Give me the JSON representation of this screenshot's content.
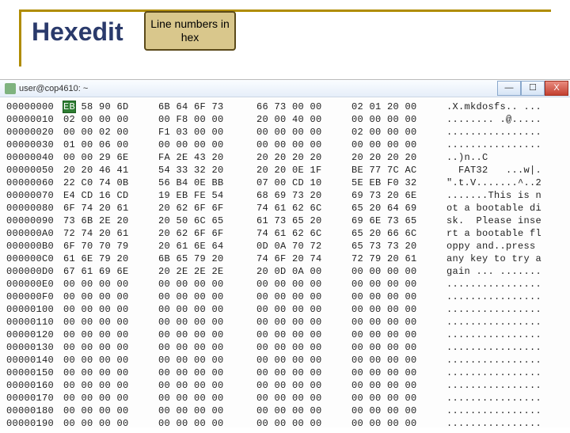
{
  "title": "Hexedit",
  "callout": "Line numbers in hex",
  "window": {
    "title": "user@cop4610: ~"
  },
  "hex_rows": [
    {
      "off": "00000000",
      "h": [
        "EB",
        "58",
        "90",
        "6D",
        "6B",
        "64",
        "6F",
        "73",
        "66",
        "73",
        "00",
        "00",
        "02",
        "01",
        "20",
        "00"
      ],
      "a": ".X.mkdosfs.. ... "
    },
    {
      "off": "00000010",
      "h": [
        "02",
        "00",
        "00",
        "00",
        "00",
        "F8",
        "00",
        "00",
        "20",
        "00",
        "40",
        "00",
        "00",
        "00",
        "00",
        "00"
      ],
      "a": "........ .@....."
    },
    {
      "off": "00000020",
      "h": [
        "00",
        "00",
        "02",
        "00",
        "F1",
        "03",
        "00",
        "00",
        "00",
        "00",
        "00",
        "00",
        "02",
        "00",
        "00",
        "00"
      ],
      "a": "................"
    },
    {
      "off": "00000030",
      "h": [
        "01",
        "00",
        "06",
        "00",
        "00",
        "00",
        "00",
        "00",
        "00",
        "00",
        "00",
        "00",
        "00",
        "00",
        "00",
        "00"
      ],
      "a": "................"
    },
    {
      "off": "00000040",
      "h": [
        "00",
        "00",
        "29",
        "6E",
        "FA",
        "2E",
        "43",
        "20",
        "20",
        "20",
        "20",
        "20",
        "20",
        "20",
        "20",
        "20"
      ],
      "a": "..)n..C         "
    },
    {
      "off": "00000050",
      "h": [
        "20",
        "20",
        "46",
        "41",
        "54",
        "33",
        "32",
        "20",
        "20",
        "20",
        "0E",
        "1F",
        "BE",
        "77",
        "7C",
        "AC"
      ],
      "a": "  FAT32   ...w|."
    },
    {
      "off": "00000060",
      "h": [
        "22",
        "C0",
        "74",
        "0B",
        "56",
        "B4",
        "0E",
        "BB",
        "07",
        "00",
        "CD",
        "10",
        "5E",
        "EB",
        "F0",
        "32"
      ],
      "a": "\".t.V.......^..2"
    },
    {
      "off": "00000070",
      "h": [
        "E4",
        "CD",
        "16",
        "CD",
        "19",
        "EB",
        "FE",
        "54",
        "68",
        "69",
        "73",
        "20",
        "69",
        "73",
        "20",
        "6E"
      ],
      "a": ".......This is n"
    },
    {
      "off": "00000080",
      "h": [
        "6F",
        "74",
        "20",
        "61",
        "20",
        "62",
        "6F",
        "6F",
        "74",
        "61",
        "62",
        "6C",
        "65",
        "20",
        "64",
        "69"
      ],
      "a": "ot a bootable di"
    },
    {
      "off": "00000090",
      "h": [
        "73",
        "6B",
        "2E",
        "20",
        "20",
        "50",
        "6C",
        "65",
        "61",
        "73",
        "65",
        "20",
        "69",
        "6E",
        "73",
        "65"
      ],
      "a": "sk.  Please inse"
    },
    {
      "off": "000000A0",
      "h": [
        "72",
        "74",
        "20",
        "61",
        "20",
        "62",
        "6F",
        "6F",
        "74",
        "61",
        "62",
        "6C",
        "65",
        "20",
        "66",
        "6C"
      ],
      "a": "rt a bootable fl"
    },
    {
      "off": "000000B0",
      "h": [
        "6F",
        "70",
        "70",
        "79",
        "20",
        "61",
        "6E",
        "64",
        "0D",
        "0A",
        "70",
        "72",
        "65",
        "73",
        "73",
        "20"
      ],
      "a": "oppy and..press "
    },
    {
      "off": "000000C0",
      "h": [
        "61",
        "6E",
        "79",
        "20",
        "6B",
        "65",
        "79",
        "20",
        "74",
        "6F",
        "20",
        "74",
        "72",
        "79",
        "20",
        "61"
      ],
      "a": "any key to try a"
    },
    {
      "off": "000000D0",
      "h": [
        "67",
        "61",
        "69",
        "6E",
        "20",
        "2E",
        "2E",
        "2E",
        "20",
        "0D",
        "0A",
        "00",
        "00",
        "00",
        "00",
        "00"
      ],
      "a": "gain ... ......."
    },
    {
      "off": "000000E0",
      "h": [
        "00",
        "00",
        "00",
        "00",
        "00",
        "00",
        "00",
        "00",
        "00",
        "00",
        "00",
        "00",
        "00",
        "00",
        "00",
        "00"
      ],
      "a": "................"
    },
    {
      "off": "000000F0",
      "h": [
        "00",
        "00",
        "00",
        "00",
        "00",
        "00",
        "00",
        "00",
        "00",
        "00",
        "00",
        "00",
        "00",
        "00",
        "00",
        "00"
      ],
      "a": "................"
    },
    {
      "off": "00000100",
      "h": [
        "00",
        "00",
        "00",
        "00",
        "00",
        "00",
        "00",
        "00",
        "00",
        "00",
        "00",
        "00",
        "00",
        "00",
        "00",
        "00"
      ],
      "a": "................"
    },
    {
      "off": "00000110",
      "h": [
        "00",
        "00",
        "00",
        "00",
        "00",
        "00",
        "00",
        "00",
        "00",
        "00",
        "00",
        "00",
        "00",
        "00",
        "00",
        "00"
      ],
      "a": "................"
    },
    {
      "off": "00000120",
      "h": [
        "00",
        "00",
        "00",
        "00",
        "00",
        "00",
        "00",
        "00",
        "00",
        "00",
        "00",
        "00",
        "00",
        "00",
        "00",
        "00"
      ],
      "a": "................"
    },
    {
      "off": "00000130",
      "h": [
        "00",
        "00",
        "00",
        "00",
        "00",
        "00",
        "00",
        "00",
        "00",
        "00",
        "00",
        "00",
        "00",
        "00",
        "00",
        "00"
      ],
      "a": "................"
    },
    {
      "off": "00000140",
      "h": [
        "00",
        "00",
        "00",
        "00",
        "00",
        "00",
        "00",
        "00",
        "00",
        "00",
        "00",
        "00",
        "00",
        "00",
        "00",
        "00"
      ],
      "a": "................"
    },
    {
      "off": "00000150",
      "h": [
        "00",
        "00",
        "00",
        "00",
        "00",
        "00",
        "00",
        "00",
        "00",
        "00",
        "00",
        "00",
        "00",
        "00",
        "00",
        "00"
      ],
      "a": "................"
    },
    {
      "off": "00000160",
      "h": [
        "00",
        "00",
        "00",
        "00",
        "00",
        "00",
        "00",
        "00",
        "00",
        "00",
        "00",
        "00",
        "00",
        "00",
        "00",
        "00"
      ],
      "a": "................"
    },
    {
      "off": "00000170",
      "h": [
        "00",
        "00",
        "00",
        "00",
        "00",
        "00",
        "00",
        "00",
        "00",
        "00",
        "00",
        "00",
        "00",
        "00",
        "00",
        "00"
      ],
      "a": "................"
    },
    {
      "off": "00000180",
      "h": [
        "00",
        "00",
        "00",
        "00",
        "00",
        "00",
        "00",
        "00",
        "00",
        "00",
        "00",
        "00",
        "00",
        "00",
        "00",
        "00"
      ],
      "a": "................"
    },
    {
      "off": "00000190",
      "h": [
        "00",
        "00",
        "00",
        "00",
        "00",
        "00",
        "00",
        "00",
        "00",
        "00",
        "00",
        "00",
        "00",
        "00",
        "00",
        "00"
      ],
      "a": "................"
    }
  ],
  "cursor": {
    "row": 0,
    "byte": 0
  }
}
